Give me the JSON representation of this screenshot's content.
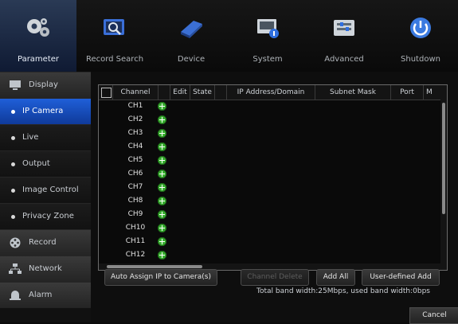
{
  "topnav": {
    "items": [
      {
        "label": "Parameter",
        "icon": "gears-icon"
      },
      {
        "label": "Record Search",
        "icon": "record-search-icon"
      },
      {
        "label": "Device",
        "icon": "hard-disk-icon"
      },
      {
        "label": "System",
        "icon": "system-info-icon"
      },
      {
        "label": "Advanced",
        "icon": "advanced-settings-icon"
      },
      {
        "label": "Shutdown",
        "icon": "power-icon"
      }
    ],
    "active": "Parameter"
  },
  "sidebar": {
    "items": [
      {
        "label": "Display",
        "type": "section",
        "icon": "monitor-icon"
      },
      {
        "label": "IP Camera",
        "type": "item",
        "active": true
      },
      {
        "label": "Live",
        "type": "item"
      },
      {
        "label": "Output",
        "type": "item"
      },
      {
        "label": "Image Control",
        "type": "item"
      },
      {
        "label": "Privacy Zone",
        "type": "item"
      },
      {
        "label": "Record",
        "type": "section",
        "icon": "film-reel-icon"
      },
      {
        "label": "Network",
        "type": "section",
        "icon": "network-icon"
      },
      {
        "label": "Alarm",
        "type": "section",
        "icon": "alarm-bell-icon"
      }
    ]
  },
  "table": {
    "headers": [
      "Channel",
      "Edit",
      "State",
      "IP Address/Domain",
      "Subnet Mask",
      "Port",
      "M"
    ],
    "rows": [
      "CH1",
      "CH2",
      "CH3",
      "CH4",
      "CH5",
      "CH6",
      "CH7",
      "CH8",
      "CH9",
      "CH10",
      "CH11",
      "CH12"
    ]
  },
  "buttons": {
    "auto_assign": "Auto Assign IP to Camera(s)",
    "channel_delete": "Channel Delete",
    "add_all": "Add All",
    "user_defined_add": "User-defined Add"
  },
  "bandwidth": "Total band width:25Mbps, used band width:0bps",
  "cancel": "Cancel",
  "colors": {
    "accent": "#1f5fd8",
    "add_icon": "#3bb232"
  }
}
